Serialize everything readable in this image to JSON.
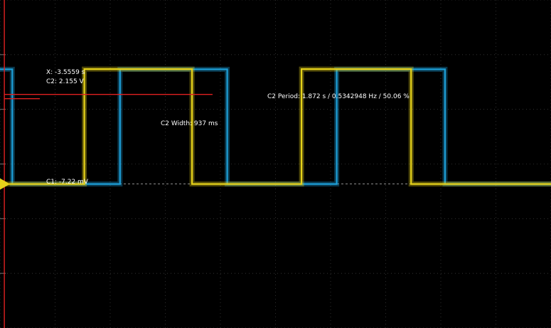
{
  "chart_data": {
    "type": "line",
    "x_unit": "s",
    "y_unit": "V",
    "xlim": [
      -3.63,
      5.78
    ],
    "ylim": [
      -2.7,
      3.45
    ],
    "grid": true,
    "trigger_level": 0,
    "series": [
      {
        "name": "C1",
        "color": "#1d9fd8",
        "points": [
          [
            -3.63,
            2.15
          ],
          [
            -3.42,
            2.15
          ],
          [
            -3.42,
            0
          ],
          [
            -1.58,
            0
          ],
          [
            -1.58,
            2.15
          ],
          [
            0.25,
            2.15
          ],
          [
            0.25,
            0
          ],
          [
            2.12,
            0
          ],
          [
            2.12,
            2.15
          ],
          [
            3.97,
            2.15
          ],
          [
            3.97,
            0
          ],
          [
            5.78,
            0
          ]
        ]
      },
      {
        "name": "C2",
        "color": "#e6d21a",
        "points": [
          [
            -3.63,
            0
          ],
          [
            -2.19,
            0
          ],
          [
            -2.19,
            2.155
          ],
          [
            -1.36,
            2.155
          ],
          [
            -1.36,
            2.155
          ],
          [
            -0.35,
            2.155
          ],
          [
            -0.35,
            0
          ],
          [
            1.52,
            0
          ],
          [
            1.52,
            2.155
          ],
          [
            3.39,
            2.155
          ],
          [
            3.39,
            0
          ],
          [
            5.78,
            0
          ]
        ]
      }
    ],
    "cursor": {
      "x": -3.5559,
      "x_label": "X: -3.5559 s",
      "c2_label": "C2: 2.155 V",
      "c1_label": "C1: -7.22 mV"
    },
    "measurements": {
      "width_line": {
        "x1": -3.5559,
        "x2": -2.95,
        "y": 1.6
      },
      "width_label": "C2 Width: 937 ms",
      "period_line": {
        "x1": -3.5559,
        "x2": 0.0,
        "y": 1.68
      },
      "period_label": "C2 Period: 1.872 s / 0.5342948 Hz / 50.06 %"
    }
  }
}
